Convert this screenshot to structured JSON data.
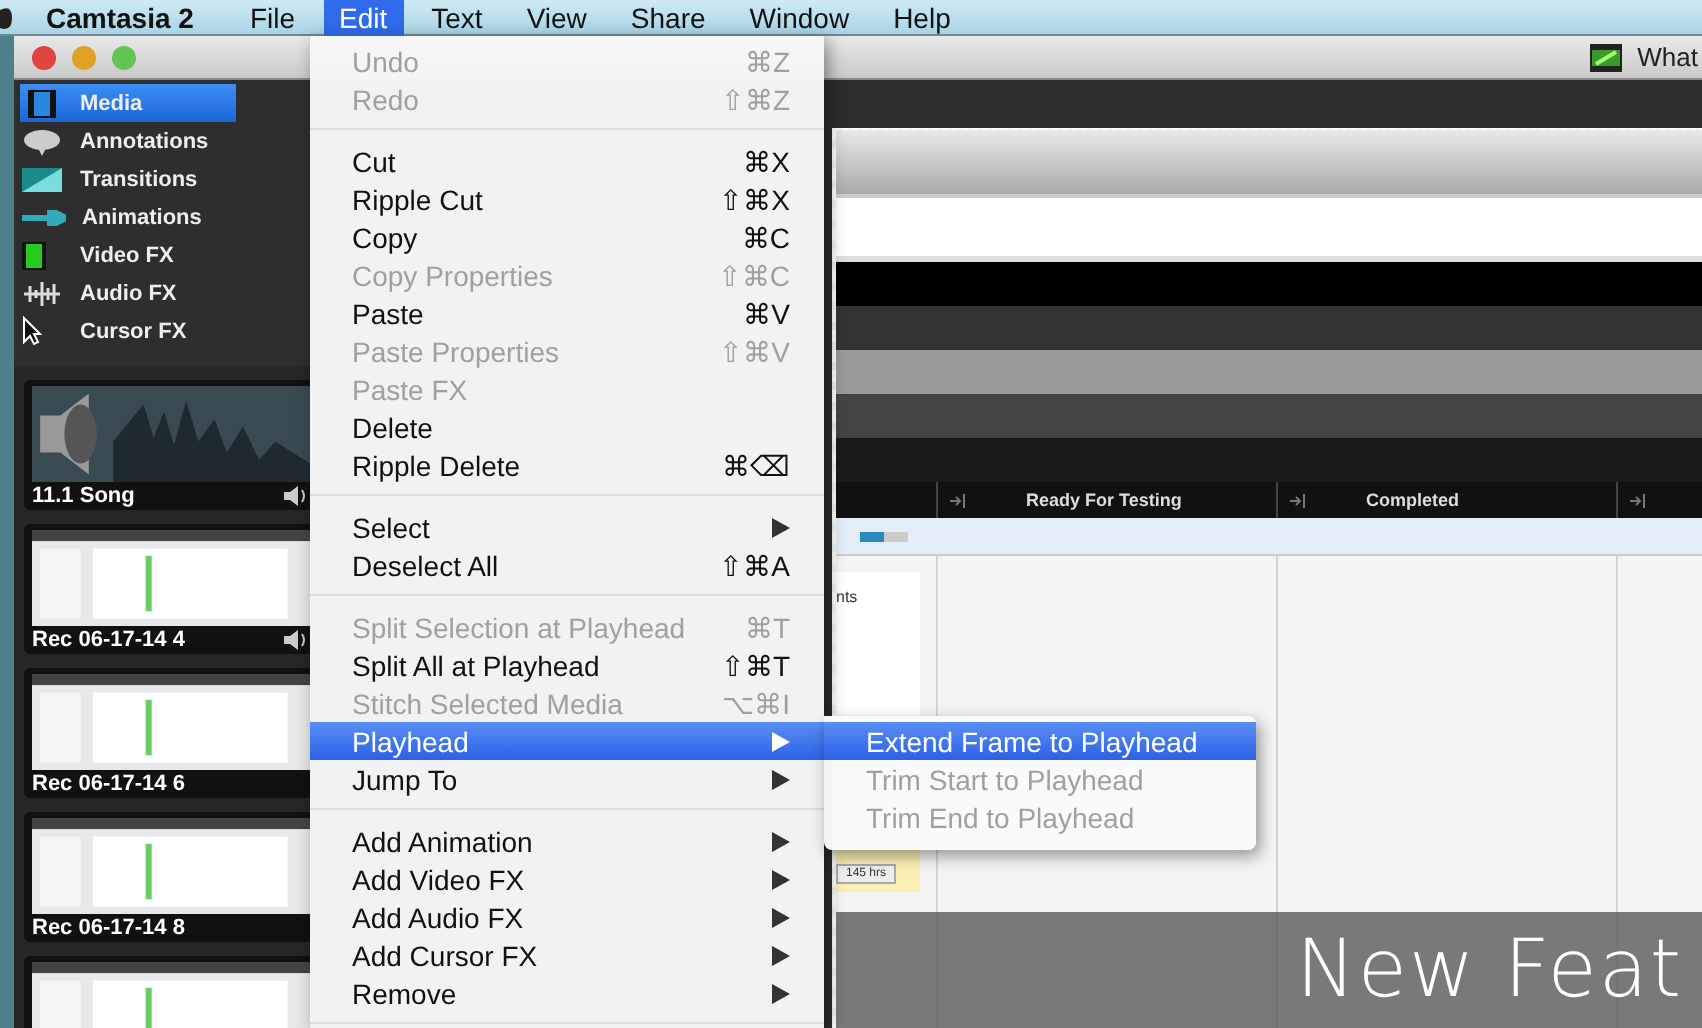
{
  "menubar": {
    "app_name": "Camtasia 2",
    "menus": [
      {
        "label": "File",
        "selected": false
      },
      {
        "label": "Edit",
        "selected": true
      },
      {
        "label": "Text",
        "selected": false
      },
      {
        "label": "View",
        "selected": false
      },
      {
        "label": "Share",
        "selected": false
      },
      {
        "label": "Window",
        "selected": false
      },
      {
        "label": "Help",
        "selected": false
      }
    ]
  },
  "window": {
    "title": "What"
  },
  "sidebar": {
    "items": [
      {
        "label": "Media",
        "selected": true
      },
      {
        "label": "Annotations",
        "selected": false
      },
      {
        "label": "Transitions",
        "selected": false
      },
      {
        "label": "Animations",
        "selected": false
      },
      {
        "label": "Video FX",
        "selected": false
      },
      {
        "label": "Audio FX",
        "selected": false
      },
      {
        "label": "Cursor FX",
        "selected": false
      }
    ]
  },
  "media_bin": {
    "clips": [
      {
        "kind": "audio",
        "label": "11.1 Song",
        "has_audio": true
      },
      {
        "kind": "screen",
        "label": "Rec 06-17-14 4",
        "has_audio": true
      },
      {
        "kind": "screen",
        "label": "Rec 06-17-14 6",
        "has_audio": false
      },
      {
        "kind": "screen",
        "label": "Rec 06-17-14 8",
        "has_audio": false
      },
      {
        "kind": "screen",
        "has_audio": false
      }
    ]
  },
  "canvas": {
    "columns": [
      {
        "label": "Ready For Testing"
      },
      {
        "label": "Completed"
      }
    ],
    "progress": {
      "level": 0.5
    },
    "card": {
      "text": "nts",
      "hours": "145 hrs"
    },
    "banner": "New Feat"
  },
  "edit_menu": {
    "items": [
      {
        "kind": "item",
        "label": "Undo",
        "shortcut": "⌘Z",
        "disabled": true,
        "submenu": false,
        "selected": false
      },
      {
        "kind": "item",
        "label": "Redo",
        "shortcut": "⇧⌘Z",
        "disabled": true,
        "submenu": false,
        "selected": false
      },
      {
        "kind": "separator"
      },
      {
        "kind": "item",
        "label": "Cut",
        "shortcut": "⌘X",
        "disabled": false,
        "submenu": false,
        "selected": false
      },
      {
        "kind": "item",
        "label": "Ripple Cut",
        "shortcut": "⇧⌘X",
        "disabled": false,
        "submenu": false,
        "selected": false
      },
      {
        "kind": "item",
        "label": "Copy",
        "shortcut": "⌘C",
        "disabled": false,
        "submenu": false,
        "selected": false
      },
      {
        "kind": "item",
        "label": "Copy Properties",
        "shortcut": "⇧⌘C",
        "disabled": true,
        "submenu": false,
        "selected": false
      },
      {
        "kind": "item",
        "label": "Paste",
        "shortcut": "⌘V",
        "disabled": false,
        "submenu": false,
        "selected": false
      },
      {
        "kind": "item",
        "label": "Paste Properties",
        "shortcut": "⇧⌘V",
        "disabled": true,
        "submenu": false,
        "selected": false
      },
      {
        "kind": "item",
        "label": "Paste FX",
        "disabled": true,
        "submenu": false,
        "selected": false
      },
      {
        "kind": "item",
        "label": "Delete",
        "disabled": false,
        "submenu": false,
        "selected": false
      },
      {
        "kind": "item",
        "label": "Ripple Delete",
        "shortcut": "⌘⌫",
        "disabled": false,
        "submenu": false,
        "selected": false
      },
      {
        "kind": "separator"
      },
      {
        "kind": "item",
        "label": "Select",
        "disabled": false,
        "submenu": true,
        "selected": false
      },
      {
        "kind": "item",
        "label": "Deselect All",
        "shortcut": "⇧⌘A",
        "disabled": false,
        "submenu": false,
        "selected": false
      },
      {
        "kind": "separator"
      },
      {
        "kind": "item",
        "label": "Split Selection at Playhead",
        "shortcut": "⌘T",
        "disabled": true,
        "submenu": false,
        "selected": false
      },
      {
        "kind": "item",
        "label": "Split All at Playhead",
        "shortcut": "⇧⌘T",
        "disabled": false,
        "submenu": false,
        "selected": false
      },
      {
        "kind": "item",
        "label": "Stitch Selected Media",
        "shortcut": "⌥⌘I",
        "disabled": true,
        "submenu": false,
        "selected": false
      },
      {
        "kind": "item",
        "label": "Playhead",
        "disabled": false,
        "submenu": true,
        "selected": true
      },
      {
        "kind": "item",
        "label": "Jump To",
        "disabled": false,
        "submenu": true,
        "selected": false
      },
      {
        "kind": "separator"
      },
      {
        "kind": "item",
        "label": "Add Animation",
        "disabled": false,
        "submenu": true,
        "selected": false
      },
      {
        "kind": "item",
        "label": "Add Video FX",
        "disabled": false,
        "submenu": true,
        "selected": false
      },
      {
        "kind": "item",
        "label": "Add Audio FX",
        "disabled": false,
        "submenu": true,
        "selected": false
      },
      {
        "kind": "item",
        "label": "Add Cursor FX",
        "disabled": false,
        "submenu": true,
        "selected": false
      },
      {
        "kind": "item",
        "label": "Remove",
        "disabled": false,
        "submenu": true,
        "selected": false
      },
      {
        "kind": "separator"
      }
    ]
  },
  "playhead_submenu": {
    "items": [
      {
        "label": "Extend Frame to Playhead",
        "disabled": false,
        "selected": true
      },
      {
        "label": "Trim Start to Playhead",
        "disabled": true,
        "selected": false
      },
      {
        "label": "Trim End to Playhead",
        "disabled": true,
        "selected": false
      }
    ]
  }
}
